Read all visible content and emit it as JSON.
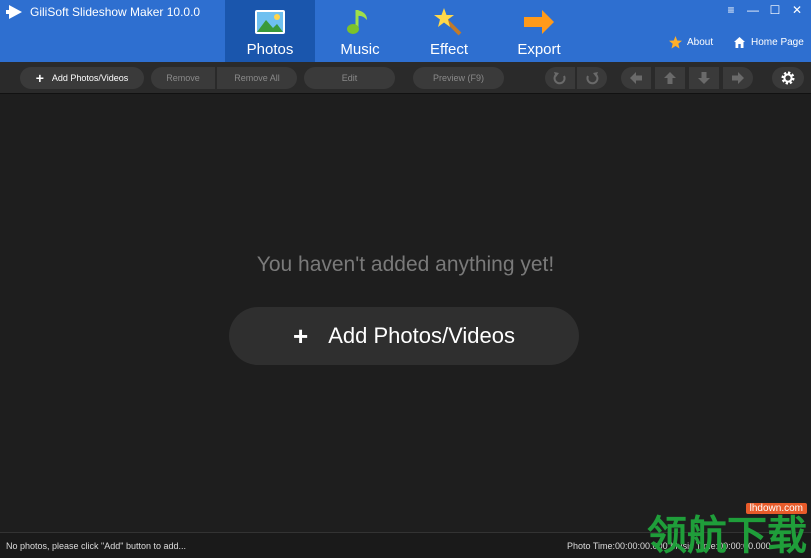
{
  "app": {
    "title": "GiliSoft Slideshow Maker 10.0.0"
  },
  "colors": {
    "header_bg": "#2e6fd0",
    "active_tab_bg": "#1a56ad",
    "canvas_bg": "#1e1e1e",
    "watermark_green": "#1f9e3a",
    "watermark_orange": "#e85b2a"
  },
  "nav": {
    "tabs": [
      {
        "label": "Photos",
        "icon": "photo-icon",
        "active": true
      },
      {
        "label": "Music",
        "icon": "music-note-icon",
        "active": false
      },
      {
        "label": "Effect",
        "icon": "magic-wand-icon",
        "active": false
      },
      {
        "label": "Export",
        "icon": "export-arrow-icon",
        "active": false
      }
    ]
  },
  "window_controls": {
    "menu_glyph": "≡",
    "minimize_glyph": "—",
    "maximize_glyph": "☐",
    "close_glyph": "✕"
  },
  "links": {
    "about": "About",
    "home_page": "Home Page"
  },
  "toolbar": {
    "add_label": "Add Photos/Videos",
    "remove_label": "Remove",
    "remove_all_label": "Remove All",
    "edit_label": "Edit",
    "preview_label": "Preview (F9)",
    "icons": [
      "rotate-left-icon",
      "rotate-right-icon",
      "arrow-left-icon",
      "arrow-up-icon",
      "arrow-down-icon",
      "arrow-right-icon",
      "gear-icon"
    ]
  },
  "main": {
    "empty_message": "You haven't added anything yet!",
    "add_button_label": "Add Photos/Videos"
  },
  "status": {
    "left_text": "No photos, please click \"Add\" button to add...",
    "right_text": "Photo Time:00:00:00.000 Music Time:00:00:00.000"
  },
  "watermark": {
    "url": "lhdown.com",
    "text": "领航下载"
  }
}
